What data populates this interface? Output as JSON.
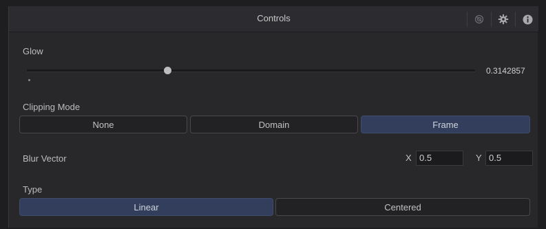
{
  "header": {
    "title": "Controls",
    "icons": [
      "visibility-icon",
      "gear-icon",
      "info-icon"
    ]
  },
  "glow": {
    "label": "Glow",
    "value": "0.3142857",
    "slider_fraction": 0.3142857
  },
  "clipping_mode": {
    "label": "Clipping Mode",
    "options": [
      "None",
      "Domain",
      "Frame"
    ],
    "selected": "Frame"
  },
  "blur_vector": {
    "label": "Blur Vector",
    "x_label": "X",
    "x_value": "0.5",
    "y_label": "Y",
    "y_value": "0.5"
  },
  "type": {
    "label": "Type",
    "options": [
      "Linear",
      "Centered"
    ],
    "selected": "Linear"
  },
  "colors": {
    "selected_button": "#323e5c",
    "panel_bg": "#28282b"
  }
}
